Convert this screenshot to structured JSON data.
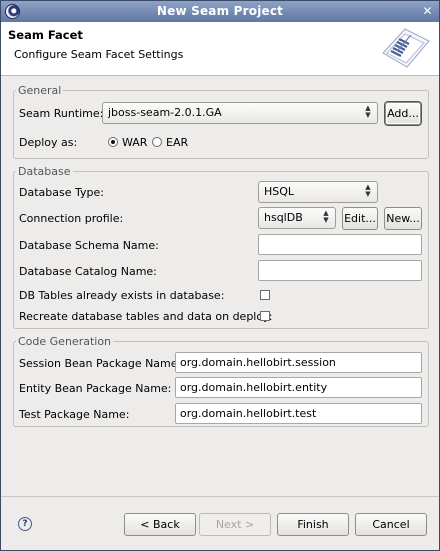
{
  "window": {
    "title": "New Seam Project"
  },
  "header": {
    "title": "Seam Facet",
    "description": "Configure Seam Facet Settings"
  },
  "general": {
    "legend": "General",
    "runtime_label": "Seam Runtime:",
    "runtime_value": "jboss-seam-2.0.1.GA",
    "add_label": "Add...",
    "deploy_label": "Deploy as:",
    "deploy_options": [
      "WAR",
      "EAR"
    ],
    "deploy_selected": "WAR"
  },
  "database": {
    "legend": "Database",
    "type_label": "Database Type:",
    "type_value": "HSQL",
    "profile_label": "Connection profile:",
    "profile_value": "hsqlDB",
    "edit_label": "Edit...",
    "new_label": "New...",
    "schema_label": "Database Schema Name:",
    "schema_value": "",
    "catalog_label": "Database Catalog Name:",
    "catalog_value": "",
    "exists_label": "DB Tables already exists in database:",
    "recreate_label": "Recreate database tables and data on deploy:"
  },
  "codegen": {
    "legend": "Code Generation",
    "session_label": "Session Bean Package Name:",
    "session_value": "org.domain.hellobirt.session",
    "entity_label": "Entity Bean Package Name:",
    "entity_value": "org.domain.hellobirt.entity",
    "test_label": "Test Package Name:",
    "test_value": "org.domain.hellobirt.test"
  },
  "footer": {
    "back_label": "Back",
    "next_label": "Next >",
    "finish_label": "Finish",
    "cancel_label": "Cancel"
  },
  "icons": {
    "app": "eclipse-icon",
    "close": "close-icon",
    "banner": "seam-wizard-banner-icon",
    "help": "help-icon"
  }
}
